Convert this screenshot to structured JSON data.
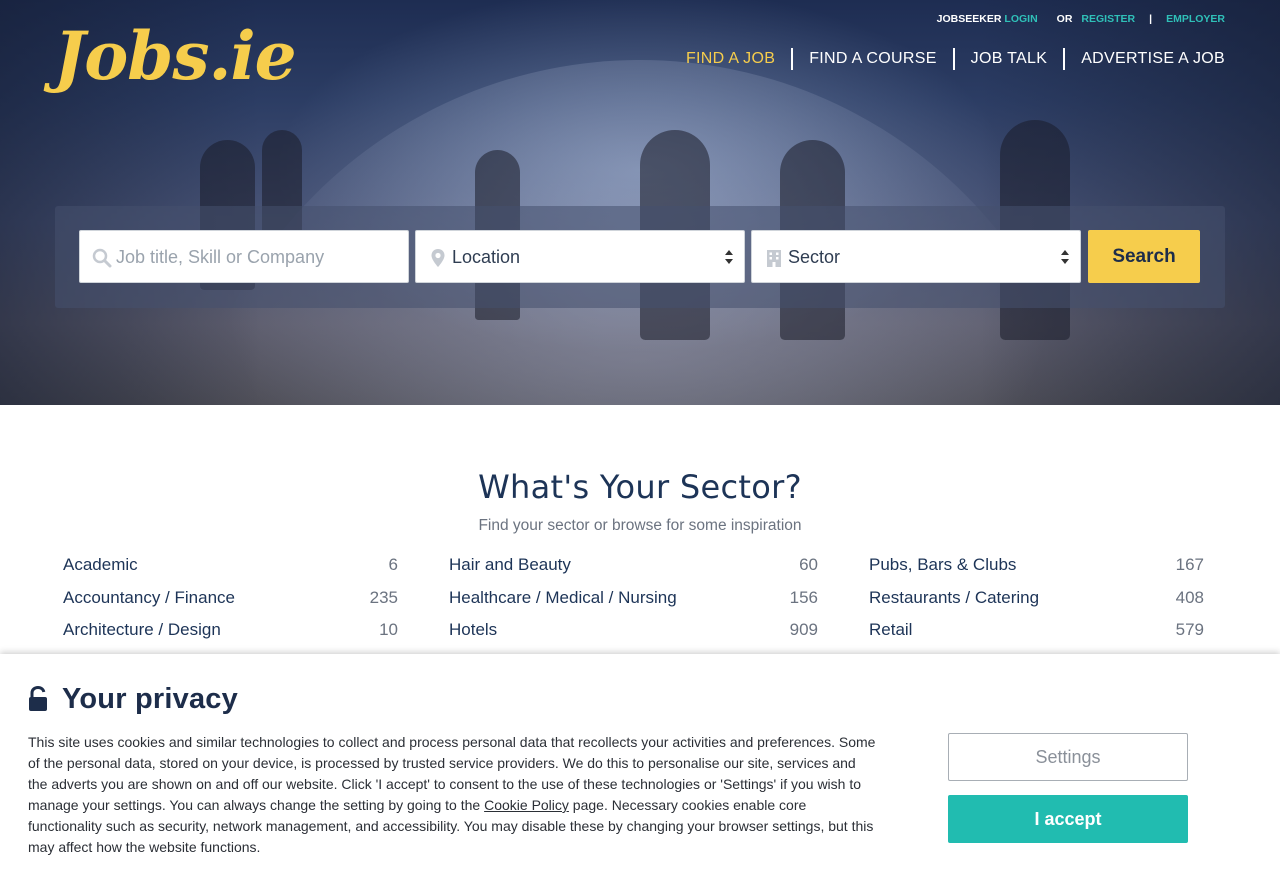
{
  "logo": {
    "text": "Jobs.ie"
  },
  "account_bar": {
    "jobseeker": "JOBSEEKER",
    "login": "LOGIN",
    "or": "OR",
    "register": "REGISTER",
    "divider": "|",
    "employer": "EMPLOYER"
  },
  "nav": {
    "items": [
      {
        "label": "FIND A JOB"
      },
      {
        "label": "FIND A COURSE"
      },
      {
        "label": "JOB TALK"
      },
      {
        "label": "ADVERTISE A JOB"
      }
    ]
  },
  "search": {
    "keyword_placeholder": "Job title, Skill or Company",
    "location_value": "Location",
    "sector_value": "Sector",
    "button_label": "Search"
  },
  "sectors": {
    "title": "What's Your Sector?",
    "subtitle": "Find your sector or browse for some inspiration",
    "columns": [
      [
        {
          "name": "Academic",
          "count": "6"
        },
        {
          "name": "Accountancy / Finance",
          "count": "235"
        },
        {
          "name": "Architecture / Design",
          "count": "10"
        }
      ],
      [
        {
          "name": "Hair and Beauty",
          "count": "60"
        },
        {
          "name": "Healthcare / Medical / Nursing",
          "count": "156"
        },
        {
          "name": "Hotels",
          "count": "909"
        }
      ],
      [
        {
          "name": "Pubs, Bars & Clubs",
          "count": "167"
        },
        {
          "name": "Restaurants / Catering",
          "count": "408"
        },
        {
          "name": "Retail",
          "count": "579"
        }
      ]
    ]
  },
  "privacy": {
    "title": "Your privacy",
    "text_before_link": "This site uses cookies and similar technologies to collect and process personal data that recollects your activities and preferences. Some of the personal data, stored on your device, is processed by trusted service providers. We do this to personalise our site, services and the adverts you are shown on and off our website. Click 'I accept' to consent to the use of these technologies or 'Settings' if you wish to manage your settings. You can always change the setting by going to the ",
    "link_label": "Cookie Policy",
    "text_after_link": " page. Necessary cookies enable core functionality such as security, network management, and accessibility. You may disable these by changing your browser settings, but this may affect how the website functions.",
    "settings_label": "Settings",
    "accept_label": "I accept"
  },
  "colors": {
    "brand_yellow": "#f6cd4c",
    "accent_teal": "#21bcb0",
    "navy": "#1d3457"
  }
}
